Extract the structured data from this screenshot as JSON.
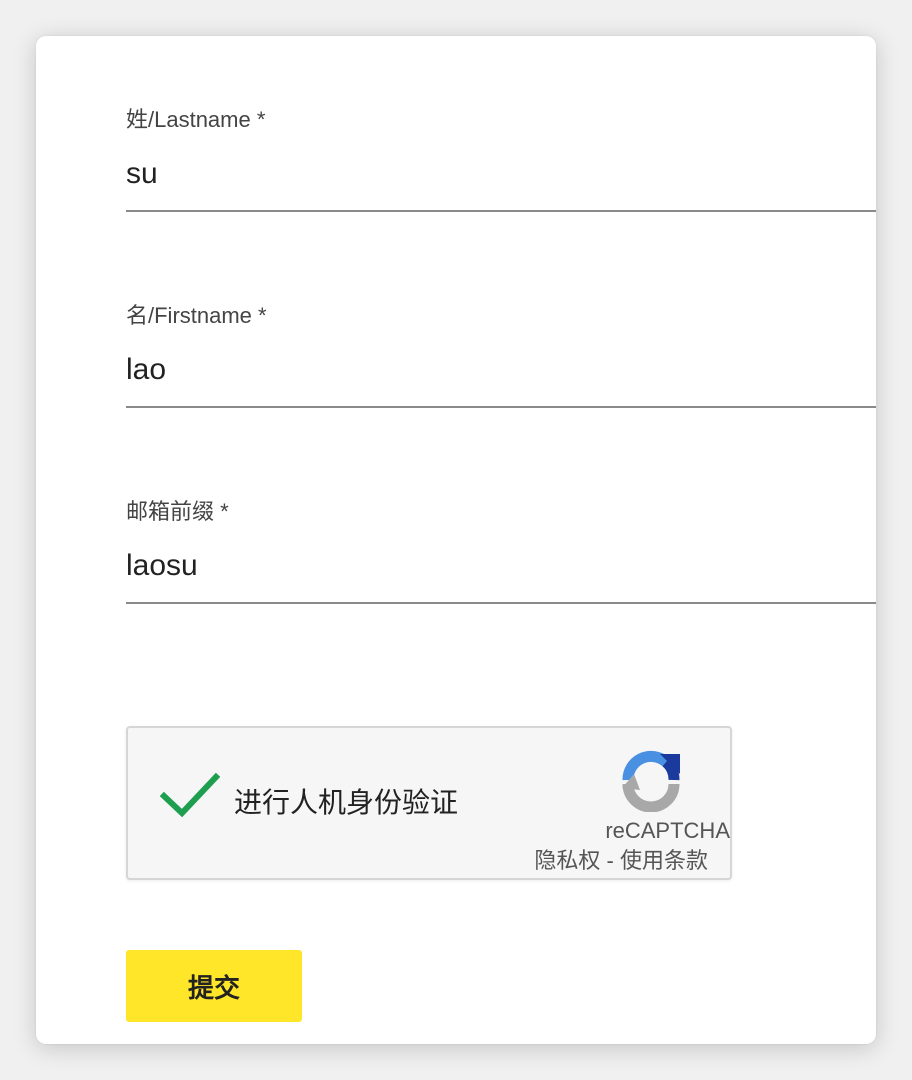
{
  "form": {
    "lastname": {
      "label": "姓/Lastname *",
      "value": "su"
    },
    "firstname": {
      "label": "名/Firstname *",
      "value": "lao"
    },
    "email_prefix": {
      "label": "邮箱前缀 *",
      "value": "laosu"
    }
  },
  "captcha": {
    "checked": true,
    "text": "进行人机身份验证",
    "brand": "reCAPTCHA",
    "privacy_link": "隐私权",
    "separator": " - ",
    "terms_link": "使用条款",
    "check_icon": "checkmark-icon",
    "logo_icon": "recaptcha-logo-icon",
    "check_color": "#1e9e4f"
  },
  "submit": {
    "label": "提交",
    "color": "#ffe629"
  }
}
